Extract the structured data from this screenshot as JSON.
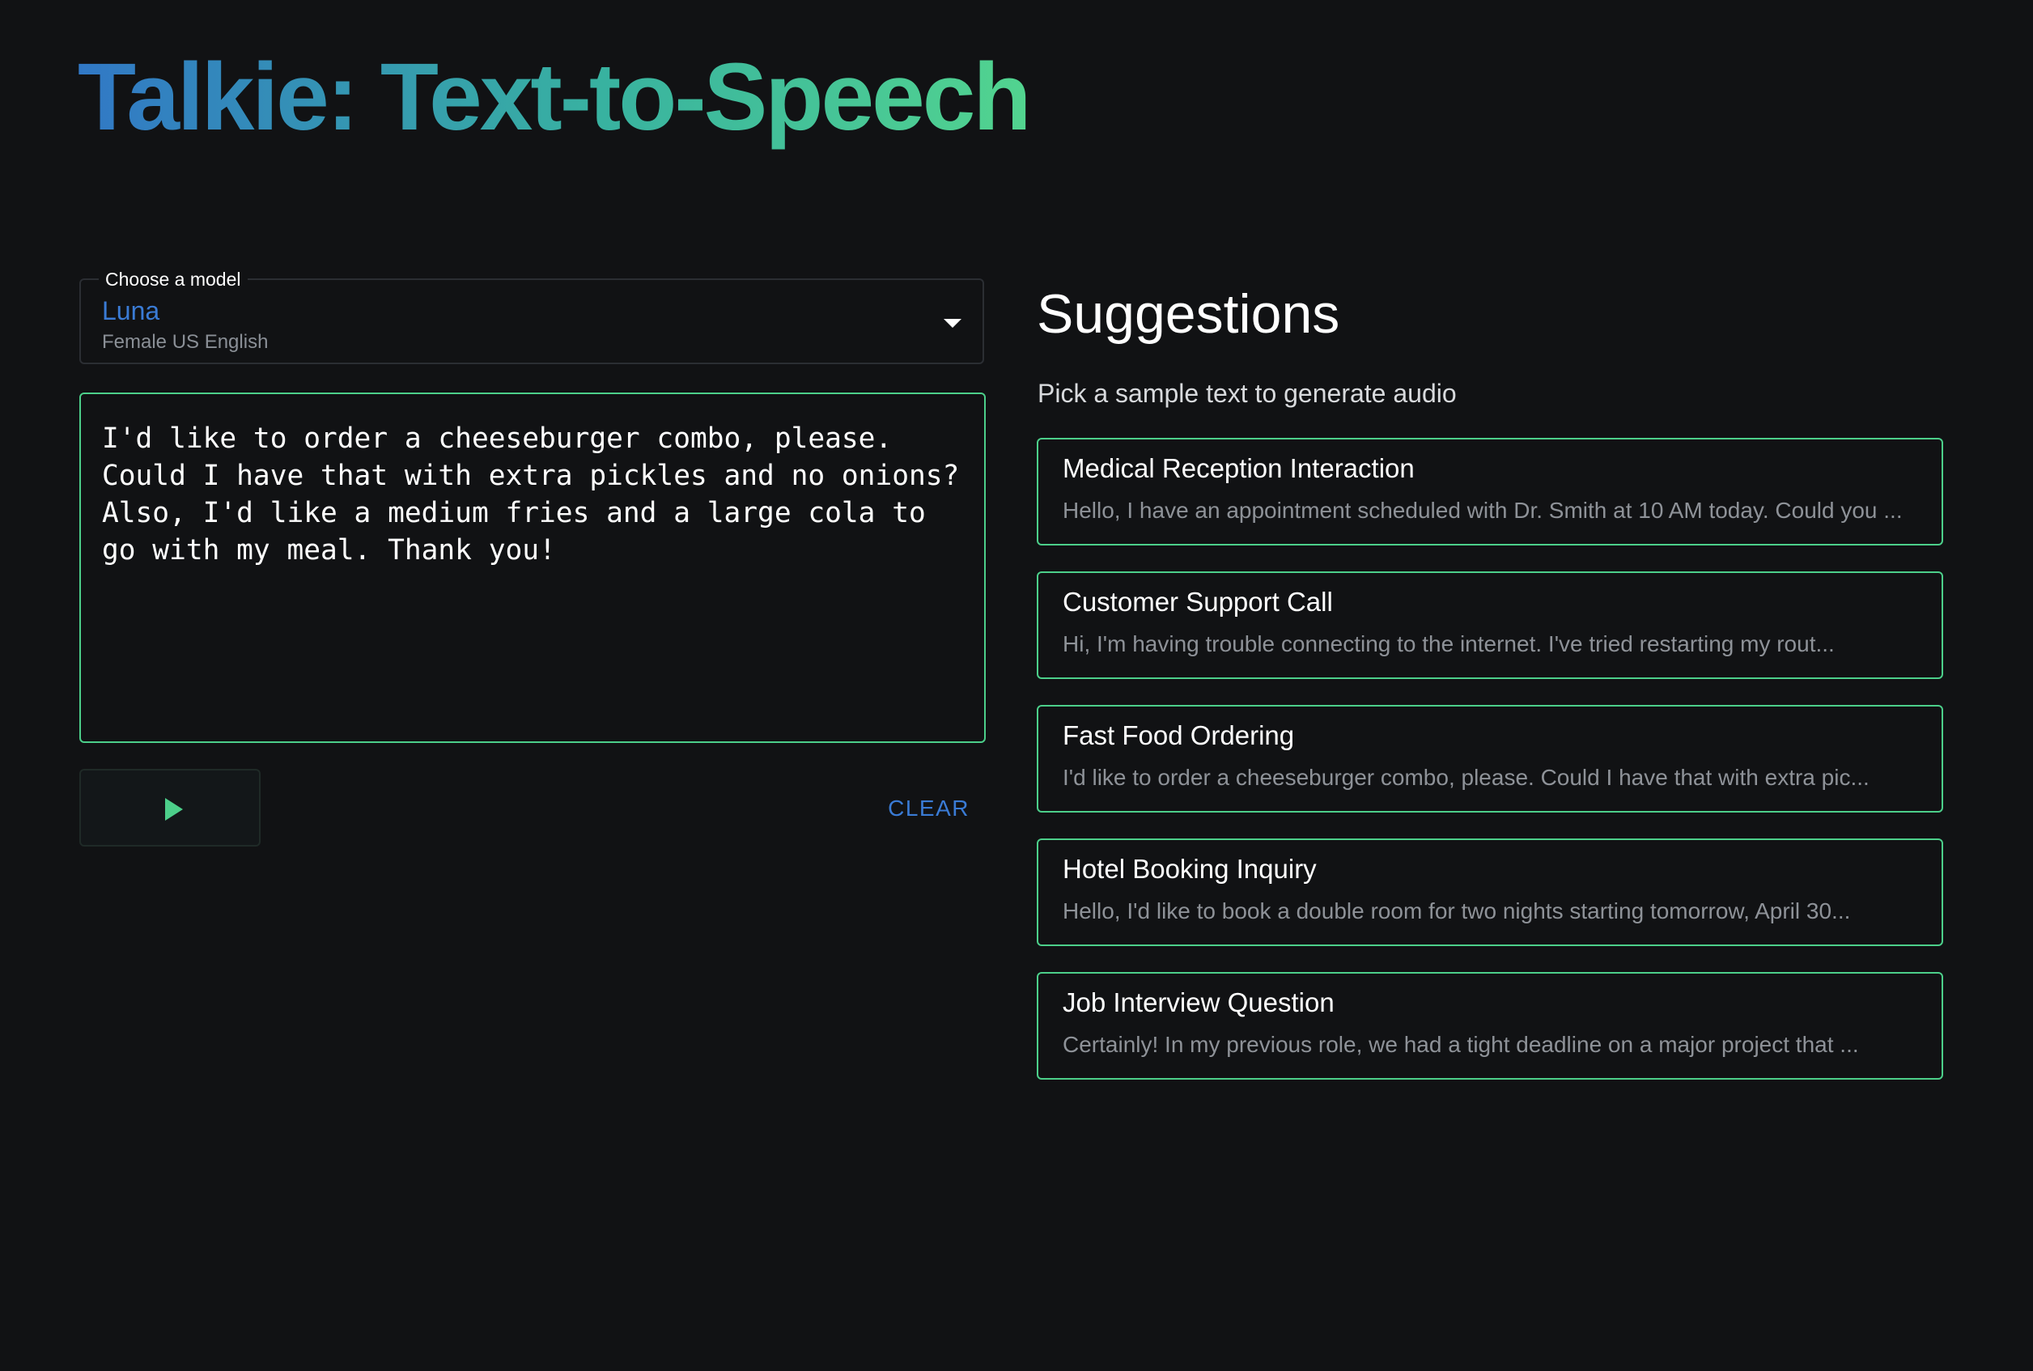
{
  "app": {
    "title": "Talkie: Text-to-Speech"
  },
  "model_select": {
    "label": "Choose a model",
    "selected_name": "Luna",
    "selected_description": "Female US English"
  },
  "text_input": {
    "value": "I'd like to order a cheeseburger combo, please. Could I have that with extra pickles and no onions? Also, I'd like a medium fries and a large cola to go with my meal. Thank you!"
  },
  "controls": {
    "play_icon": "play-icon",
    "clear_label": "CLEAR"
  },
  "suggestions": {
    "title": "Suggestions",
    "subtitle": "Pick a sample text to generate audio",
    "items": [
      {
        "title": "Medical Reception Interaction",
        "preview": "Hello, I have an appointment scheduled with Dr. Smith at 10 AM today. Could you ..."
      },
      {
        "title": "Customer Support Call",
        "preview": "Hi, I'm having trouble connecting to the internet. I've tried restarting my rout..."
      },
      {
        "title": "Fast Food Ordering",
        "preview": "I'd like to order a cheeseburger combo, please. Could I have that with extra pic..."
      },
      {
        "title": "Hotel Booking Inquiry",
        "preview": "Hello, I'd like to book a double room for two nights starting tomorrow, April 30..."
      },
      {
        "title": "Job Interview Question",
        "preview": "Certainly! In my previous role, we had a tight deadline on a major project that ..."
      }
    ]
  },
  "colors": {
    "background": "#111214",
    "accent_green": "#4ccf8a",
    "accent_blue": "#3a7bd5",
    "title_gradient_start": "#3178c6",
    "title_gradient_end": "#52d48f"
  }
}
